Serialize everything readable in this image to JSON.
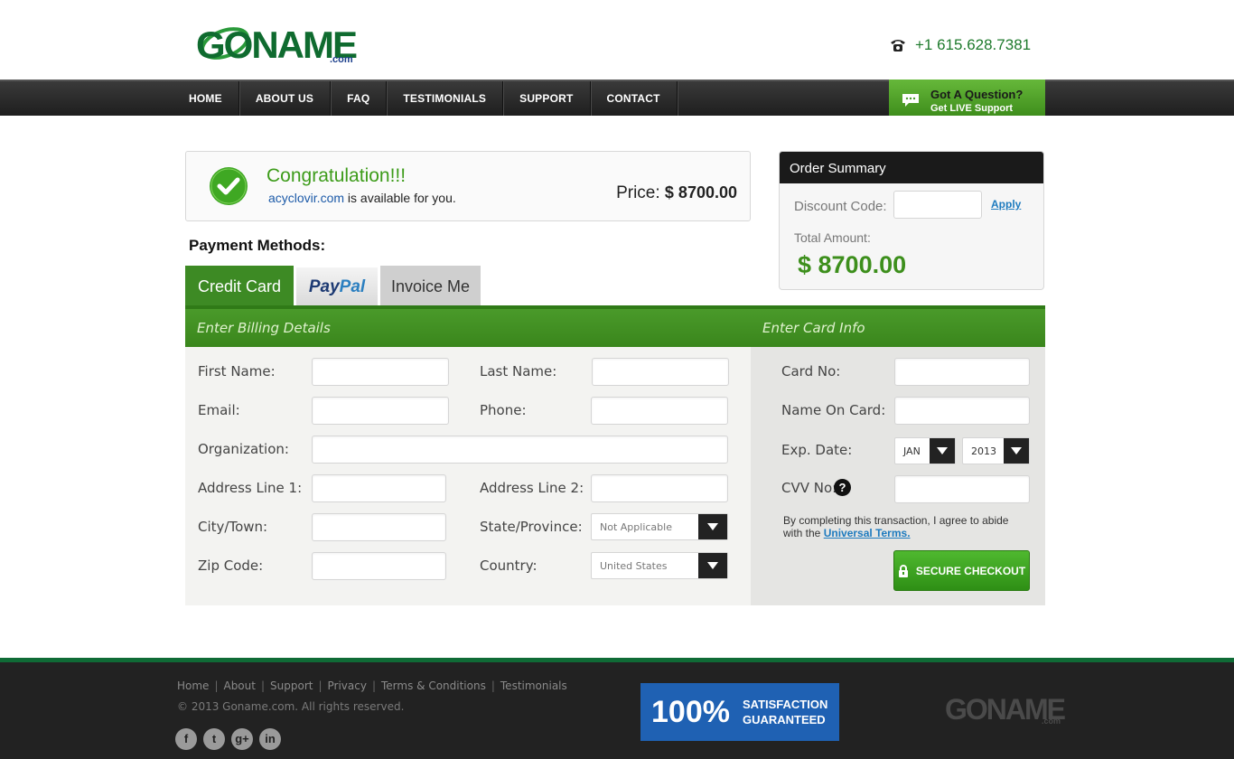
{
  "header": {
    "logo_text": "GONAME",
    "logo_suffix": ".com",
    "phone": "+1 615.628.7381"
  },
  "nav": {
    "items": [
      "HOME",
      "ABOUT US",
      "FAQ",
      "TESTIMONIALS",
      "SUPPORT",
      "CONTACT"
    ],
    "question_title": "Got A Question?",
    "question_sub": "Get LIVE Support"
  },
  "congrats": {
    "title": "Congratulation!!!",
    "domain": "acyclovir.com",
    "availability": " is available for you.",
    "price_label": "Price:",
    "price_value": "$ 8700.00"
  },
  "payment": {
    "title": "Payment Methods:",
    "tabs": [
      "Credit Card",
      "PayPal",
      "Invoice Me"
    ],
    "paypal_part1": "Pay",
    "paypal_part2": "Pal"
  },
  "billing": {
    "section_title": "Enter Billing Details",
    "first_name": "First Name:",
    "last_name": "Last Name:",
    "email": "Email:",
    "phone": "Phone:",
    "organization": "Organization:",
    "address1": "Address Line 1:",
    "address2": "Address Line 2:",
    "city": "City/Town:",
    "state": "State/Province:",
    "state_value": "Not Applicable",
    "zip": "Zip Code:",
    "country": "Country:",
    "country_value": "United States"
  },
  "card": {
    "section_title": "Enter Card Info",
    "card_no": "Card No:",
    "name_on_card": "Name On Card:",
    "exp_date": "Exp. Date:",
    "exp_month": "JAN",
    "exp_year": "2013",
    "cvv": "CVV No:",
    "agree_text": "By completing this transaction, I agree to abide with the ",
    "terms_link": "Universal Terms.",
    "checkout_label": "SECURE CHECKOUT"
  },
  "summary": {
    "title": "Order Summary",
    "discount_label": "Discount Code:",
    "apply_label": "Apply",
    "total_label": "Total Amount:",
    "total_value": "$ 8700.00"
  },
  "footer": {
    "links": [
      "Home",
      "About",
      "Support",
      "Privacy",
      "Terms & Conditions",
      "Testimonials"
    ],
    "copyright": "© 2013 Goname.com. All rights reserved.",
    "badge_pct": "100%",
    "badge_line1": "SATISFACTION",
    "badge_line2": "GUARANTEED",
    "logo_text": "GONAME",
    "logo_suffix": ".com",
    "social_icons": [
      "facebook-icon",
      "twitter-icon",
      "google-plus-icon",
      "linkedin-icon"
    ]
  },
  "colors": {
    "brand_green": "#3d8a24",
    "nav_dark": "#1e1e1e",
    "link_blue": "#1e7bbf"
  }
}
